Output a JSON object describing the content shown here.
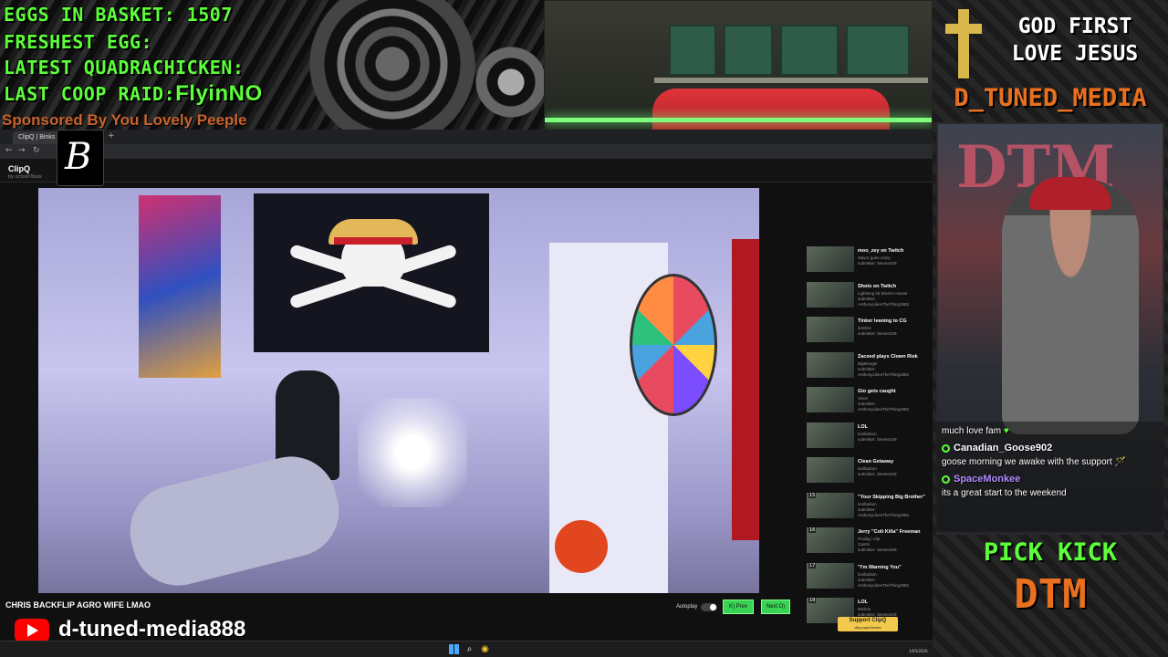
{
  "overlay": {
    "eggs_line": "EGGS IN BASKET: 1507",
    "freshest_line": "FRESHEST EGG:",
    "quadrachicken_line": "LATEST QUADRACHICKEN:",
    "raid_label": "LAST COOP RAID:",
    "raid_name": "FlyinNO",
    "sponsor_line": "Sponsored By You Lovely Peeple",
    "motto_1": "GOD FIRST",
    "motto_2": "LOVE JESUS",
    "brand": "D_TUNED_MEDIA",
    "pick": "PICK KICK",
    "dtm": "DTM",
    "cam_sign": "DTM",
    "youtube_handle": "d-tuned-media888"
  },
  "chat": [
    {
      "user": "",
      "text": "much love fam",
      "emoji": "♥"
    },
    {
      "user": "Canadian_Goose902",
      "user_color": "#ffffff",
      "text": "goose morning we awake with the support",
      "emoji": "🪄"
    },
    {
      "user": "SpaceMonkee",
      "user_color": "#b48cff",
      "text": "its a great start to the weekend",
      "emoji": ""
    }
  ],
  "browser": {
    "tab_title": "ClipQ | Binks",
    "tab_close": "×",
    "new_tab": "+",
    "app_name": "ClipQ",
    "app_subtitle": "by octoshTools",
    "logo_letter": "B",
    "nav_back": "←",
    "nav_forward": "→",
    "nav_reload": "↻"
  },
  "player": {
    "video_title": "CHRIS BACKFLIP AGRO WIFE LMAO",
    "autoplay_label": "Autoplay",
    "prev_label": "K) Prev",
    "next_label": "Next D)",
    "support_label": "Support ClipQ",
    "support_sub": "clipq.app/donate"
  },
  "playlist": [
    {
      "num": "",
      "title": "moo_zey on Twitch",
      "meta1": "Mayor goes crazy",
      "meta2": "submitter: Steven429"
    },
    {
      "num": "",
      "title": "Shots on Twitch",
      "meta1": "Lightning hit Shots's House",
      "meta2": "submitter:",
      "meta3": "AnthonyLikesTheThing1982"
    },
    {
      "num": "",
      "title": "Tinker leaning to CG",
      "meta1": "NAIDIA",
      "meta2": "submitter: Steven429"
    },
    {
      "num": "",
      "title": "Zaceed plays Clown Risk",
      "meta1": "BigMonger",
      "meta2": "submitter:",
      "meta3": "AnthonyLikesTheThing1982"
    },
    {
      "num": "",
      "title": "Gio gets caught",
      "meta1": "Vexer",
      "meta2": "submitter:",
      "meta3": "AnthonyLikesTheThing1982"
    },
    {
      "num": "",
      "title": "LOL",
      "meta1": "lordlodson",
      "meta2": "submitter: Steven429"
    },
    {
      "num": "",
      "title": "Clean Getaway",
      "meta1": "lordlodson",
      "meta2": "submitter: Steven429"
    },
    {
      "num": "15",
      "title": "\"Your Skipping Big Brother\"",
      "meta1": "lordlodson",
      "meta2": "submitter:",
      "meta3": "AnthonyLikesTheThing1982"
    },
    {
      "num": "16",
      "title": "Jerry \"Colt Killa\" Freeman",
      "meta1": "Prodig | Clip",
      "meta2": "CanIN",
      "meta3": "submitter: Steven429"
    },
    {
      "num": "17",
      "title": "\"I'm Warning You\"",
      "meta1": "lordlodson",
      "meta2": "submitter:",
      "meta3": "AnthonyLikesTheThing1982"
    },
    {
      "num": "18",
      "title": "LOL",
      "meta1": "Barbos",
      "meta2": "submitter: Steven429"
    }
  ],
  "taskbar": {
    "date": "1/05/2026",
    "search_glyph": "⌕",
    "chrome_glyph": "◉"
  }
}
